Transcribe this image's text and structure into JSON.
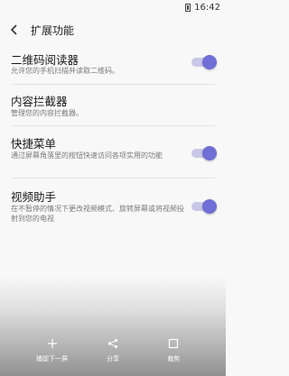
{
  "status_bar": {
    "time": "16:42"
  },
  "app_bar": {
    "title": "扩展功能"
  },
  "settings": [
    {
      "title": "二维码阅读器",
      "desc": "允许您的手机扫描并读取二维码。",
      "toggle": true
    },
    {
      "title": "内容拦截器",
      "desc": "管理您的内容拦截器。",
      "toggle": false
    },
    {
      "title": "快捷菜单",
      "desc": "通过屏幕角落里的按钮快速访问各项实用的功能",
      "toggle": true
    },
    {
      "title": "视频助手",
      "desc": "在不暂停的情况下更改视频模式、旋转屏幕或将视频投射到您的电视",
      "toggle": true
    }
  ],
  "bottom_bar": {
    "capture_label": "捕捉下一屏",
    "share_label": "分享",
    "crop_label": "裁剪"
  }
}
